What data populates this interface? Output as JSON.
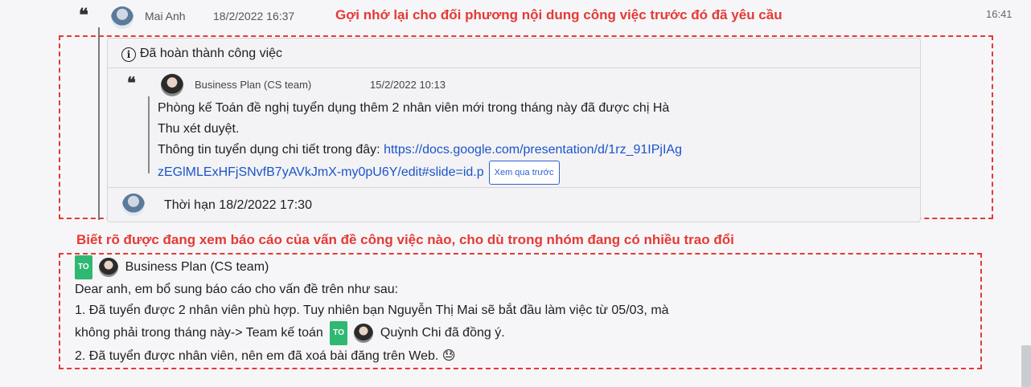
{
  "header": {
    "quote_icon": "quote-icon",
    "author": "Mai Anh",
    "datetime": "18/2/2022 16:37",
    "annotation": "Gợi nhớ lại cho đối phương nội dung công việc trước đó đã yêu cầu",
    "time_right": "16:41"
  },
  "task_card": {
    "info_icon": "info-icon",
    "status": "Đã hoàn thành công việc",
    "quoted": {
      "author": "Business Plan (CS team)",
      "datetime": "15/2/2022 10:13",
      "line1": "Phòng kế Toán đề nghị tuyển dụng thêm 2 nhân viên mới trong tháng này đã được chị Hà",
      "line2": "Thu xét duyệt.",
      "line3_prefix": "Thông tin tuyển dụng chi tiết trong đây: ",
      "link_part1": "https://docs.google.com/presentation/d/1rz_91IPjIAg",
      "link_part2": "zEGlMLExHFjSNvfB7yAVkJmX-my0pU6Y/edit#slide=id.p",
      "preview_button": "Xem qua trước"
    },
    "deadline": "Thời hạn 18/2/2022 17:30"
  },
  "annotation2": "Biết rõ được đang xem báo cáo của vấn đề công việc nào, cho dù trong nhóm đang có nhiều trao đổi",
  "message": {
    "to_tag": "TO",
    "recipient": "Business Plan (CS team)",
    "greeting": "Dear anh, em bổ sung báo cáo cho vấn đề trên như sau:",
    "item1_a": "1. Đã tuyển được 2 nhân viên phù hợp. Tuy nhiên bạn Nguyễn Thị Mai sẽ bắt đầu làm việc từ 05/03, mà",
    "item1_b": "không phải trong tháng này-> Team kế toán",
    "mention_tag": "TO",
    "mention_name": "Quỳnh Chi đã đồng ý.",
    "item2": "2. Đã tuyển được nhân viên, nên em đã xoá bài đăng trên Web.",
    "emoji": "😓"
  }
}
